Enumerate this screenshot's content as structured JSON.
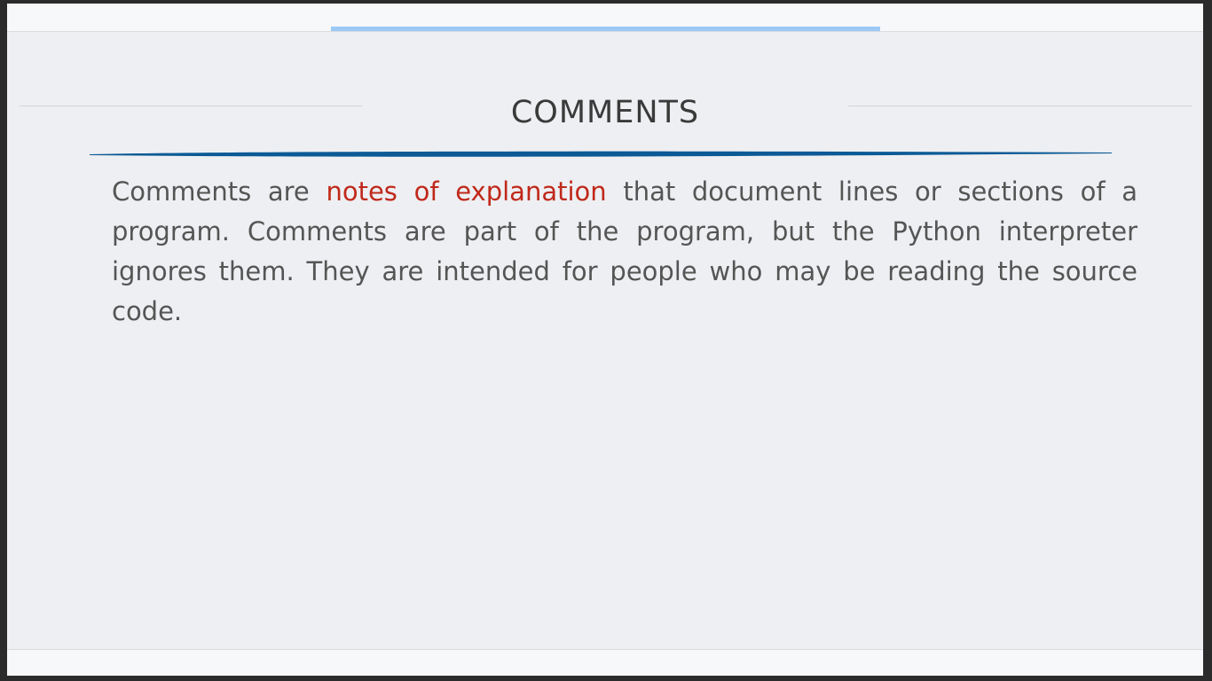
{
  "slide": {
    "title": "COMMENTS",
    "body": {
      "before": "Comments are ",
      "highlight": "notes of explanation",
      "after": " that document lines or sections of a program. Comments are part of the program, but the Python interpreter ignores them. They are intended for people who may be reading the source code."
    }
  },
  "colors": {
    "highlight": "#c0291b",
    "accent_bar": "#9cc9f5",
    "brush_stroke": "#0b5a96"
  }
}
